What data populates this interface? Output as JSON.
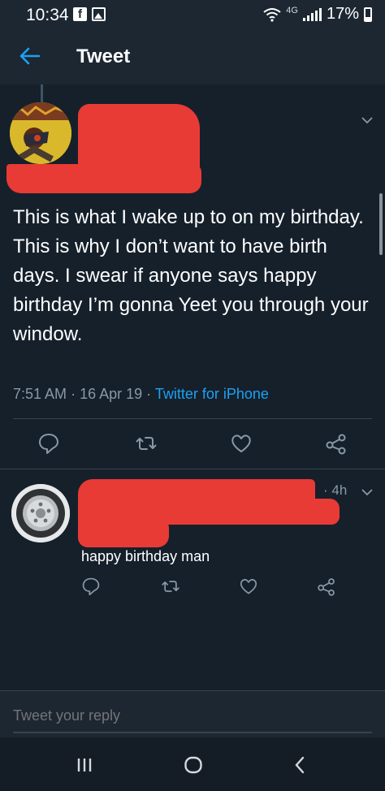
{
  "status_bar": {
    "time": "10:34",
    "network": "4G",
    "battery": "17%"
  },
  "header": {
    "title": "Tweet"
  },
  "tweet": {
    "text": "This is what I wake up to on my birthday. This is why I don’t want to have birth days. I swear if anyone says happy birthday I’m gonna Yeet you through your window.",
    "time": "7:51 AM",
    "date": "16 Apr 19",
    "source": "Twitter for iPhone"
  },
  "reply": {
    "age": "4h",
    "text": "happy birthday man"
  },
  "compose": {
    "placeholder": "Tweet your reply"
  },
  "icons": {
    "back": "arrow-left-icon",
    "caret": "chevron-down-icon",
    "reply": "comment-icon",
    "retweet": "retweet-icon",
    "like": "heart-icon",
    "share": "share-icon"
  },
  "colors": {
    "background": "#15202b",
    "bar": "#1c2732",
    "accent": "#1da1f2",
    "secondary_text": "#8899a6",
    "redaction": "#e83b35"
  }
}
